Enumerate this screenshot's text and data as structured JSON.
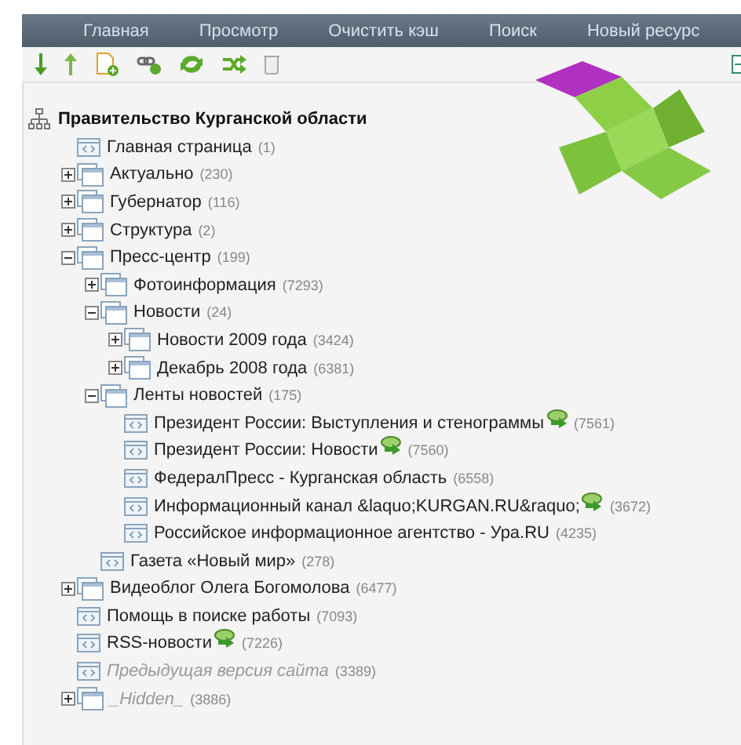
{
  "nav": [
    {
      "label": "Главная"
    },
    {
      "label": "Просмотр"
    },
    {
      "label": "Очистить кэш"
    },
    {
      "label": "Поиск"
    },
    {
      "label": "Новый ресурс"
    }
  ],
  "toolbar": [
    {
      "kind": "down"
    },
    {
      "kind": "up"
    },
    {
      "kind": "new-page"
    },
    {
      "kind": "new-link"
    },
    {
      "kind": "refresh"
    },
    {
      "kind": "sort"
    },
    {
      "kind": "trash"
    }
  ],
  "tree": {
    "title": "Правительство Курганской области",
    "children": [
      {
        "name": "Главная страница",
        "count": "(1)",
        "kind": "page",
        "feed": false,
        "unpublished": false
      },
      {
        "name": "Актуально",
        "count": "(230)",
        "kind": "folder",
        "expanded": false,
        "feed": false,
        "unpublished": false
      },
      {
        "name": "Губернатор",
        "count": "(116)",
        "kind": "folder",
        "expanded": false,
        "feed": false,
        "unpublished": false
      },
      {
        "name": "Структура",
        "count": "(2)",
        "kind": "folder",
        "expanded": false,
        "feed": false,
        "unpublished": false
      },
      {
        "name": "Пресс-центр",
        "count": "(199)",
        "kind": "folder",
        "expanded": true,
        "feed": false,
        "unpublished": false,
        "children": [
          {
            "name": "Фотоинформация",
            "count": "(7293)",
            "kind": "folder",
            "expanded": false,
            "feed": false,
            "unpublished": false
          },
          {
            "name": "Новости",
            "count": "(24)",
            "kind": "folder",
            "expanded": true,
            "feed": false,
            "unpublished": false,
            "children": [
              {
                "name": "Новости 2009 года",
                "count": "(3424)",
                "kind": "folder",
                "expanded": false,
                "feed": false,
                "unpublished": false
              },
              {
                "name": "Декабрь 2008 года",
                "count": "(6381)",
                "kind": "folder",
                "expanded": false,
                "feed": false,
                "unpublished": false
              }
            ]
          },
          {
            "name": "Ленты новостей",
            "count": "(175)",
            "kind": "folder",
            "expanded": true,
            "feed": false,
            "unpublished": false,
            "children": [
              {
                "name": "Президент России: Выступления и стенограммы",
                "count": "(7561)",
                "kind": "page",
                "feed": true,
                "unpublished": false
              },
              {
                "name": "Президент России: Новости",
                "count": "(7560)",
                "kind": "page",
                "feed": true,
                "unpublished": false
              },
              {
                "name": "ФедералПресс - Курганская область",
                "count": "(6558)",
                "kind": "page",
                "feed": false,
                "unpublished": false
              },
              {
                "name": "Информационный канал &laquo;KURGAN.RU&raquo;",
                "count": "(3672)",
                "kind": "page",
                "feed": true,
                "unpublished": false
              },
              {
                "name": "Российское информационное агентство - Ура.RU",
                "count": "(4235)",
                "kind": "page",
                "feed": false,
                "unpublished": false
              }
            ]
          },
          {
            "name": "Газета «Новый мир»",
            "count": "(278)",
            "kind": "page",
            "feed": false,
            "unpublished": false
          }
        ]
      },
      {
        "name": "Видеоблог Олега Богомолова",
        "count": "(6477)",
        "kind": "folder",
        "expanded": false,
        "feed": false,
        "unpublished": false
      },
      {
        "name": "Помощь в поиске работы",
        "count": "(7093)",
        "kind": "page",
        "feed": false,
        "unpublished": false
      },
      {
        "name": "RSS-новости",
        "count": "(7226)",
        "kind": "page",
        "feed": true,
        "unpublished": false
      },
      {
        "name": "Предыдущая версия сайта",
        "count": "(3389)",
        "kind": "page",
        "feed": false,
        "unpublished": true
      },
      {
        "name": "_Hidden_",
        "count": "(3886)",
        "kind": "folder",
        "expanded": false,
        "feed": false,
        "unpublished": true
      }
    ]
  }
}
